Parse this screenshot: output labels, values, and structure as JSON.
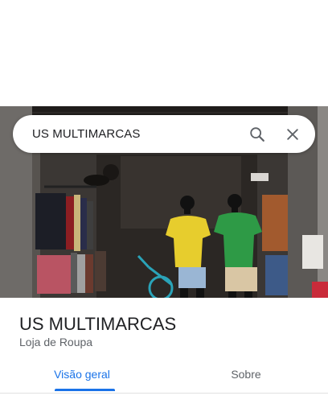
{
  "search": {
    "query": "US MULTIMARCAS"
  },
  "place": {
    "name": "US MULTIMARCAS",
    "category": "Loja de Roupa"
  },
  "tabs": [
    {
      "label": "Visão geral",
      "active": true
    },
    {
      "label": "Sobre",
      "active": false
    }
  ],
  "icons": {
    "search": "search-icon",
    "close": "close-icon"
  },
  "colors": {
    "accent": "#1a73e8",
    "text_primary": "#202124",
    "text_secondary": "#5f6368"
  }
}
